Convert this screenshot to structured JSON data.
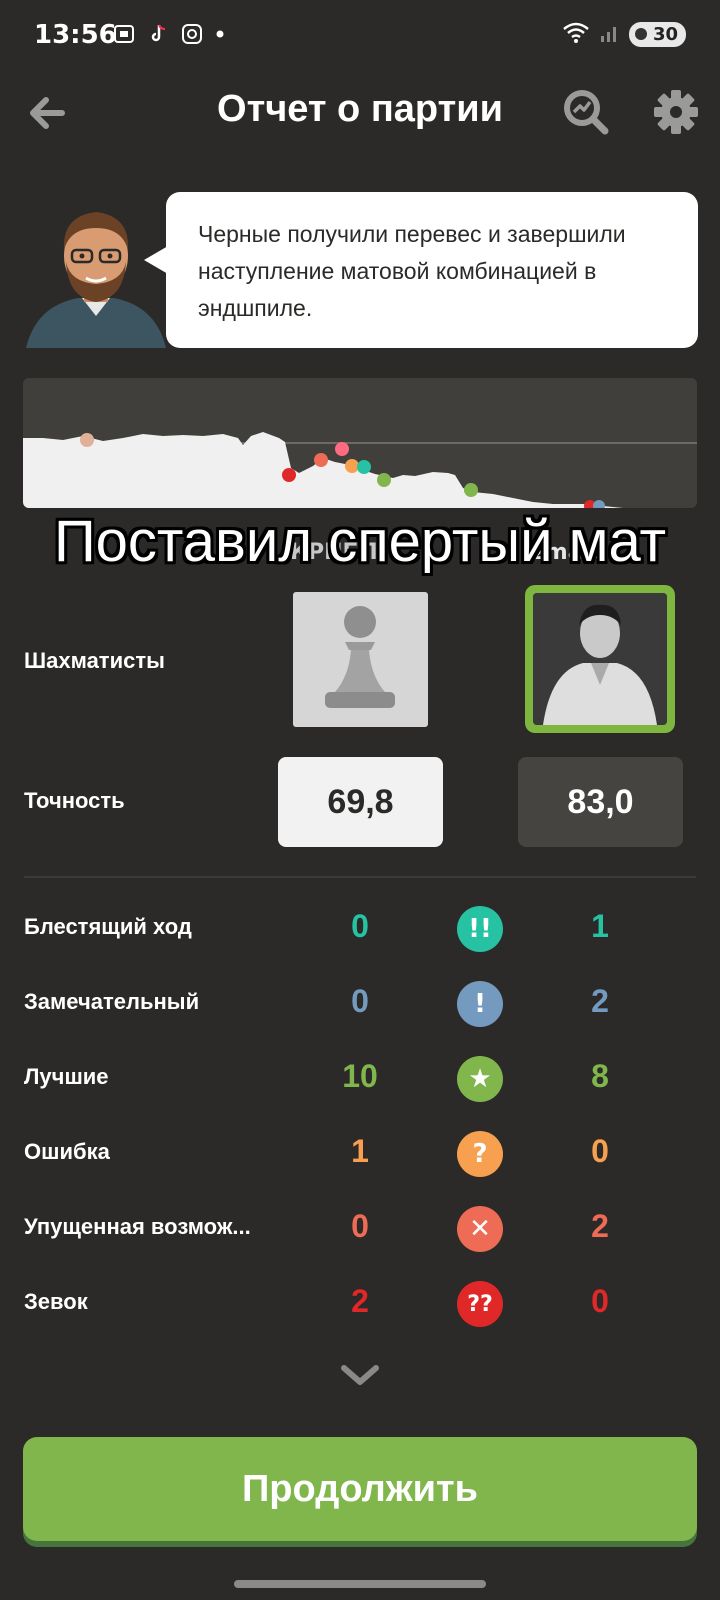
{
  "status_bar": {
    "time": "13:56",
    "battery": "30",
    "left_icons": [
      "screenshot-icon",
      "tiktok-icon",
      "instagram-icon",
      "dot-icon"
    ],
    "right_icons": [
      "wifi-icon",
      "signal-icon",
      "battery-icon"
    ]
  },
  "header": {
    "title": "Отчет о партии",
    "icons": [
      "back-arrow-icon",
      "analysis-search-icon",
      "gear-icon"
    ]
  },
  "coach": {
    "message": "Черные получили перевес и завершили наступление матовой комбинацией в эндшпиле."
  },
  "overlay_caption": "Поставил спертый мат",
  "players": {
    "row_label": "Шахматисты",
    "white_name": "КРНБП",
    "black_name": "zmate",
    "white_avatar_icon": "pawn-icon",
    "black_avatar_icon": "player-photo"
  },
  "accuracy": {
    "label": "Точность",
    "white": "69,8",
    "black": "83,0"
  },
  "stats": [
    {
      "label": "Блестящий ход",
      "white": "0",
      "black": "1",
      "icon": "brilliant-icon",
      "symbol": "!!",
      "color": "#26c2a3"
    },
    {
      "label": "Замечательный",
      "white": "0",
      "black": "2",
      "icon": "great-move-icon",
      "symbol": "!",
      "color": "#749bbf"
    },
    {
      "label": "Лучшие",
      "white": "10",
      "black": "8",
      "icon": "best-move-star-icon",
      "symbol": "★",
      "color": "#81b64c"
    },
    {
      "label": "Ошибка",
      "white": "1",
      "black": "0",
      "icon": "mistake-icon",
      "symbol": "?",
      "color": "#f7a04f"
    },
    {
      "label": "Упущенная возмож...",
      "white": "0",
      "black": "2",
      "icon": "miss-icon",
      "symbol": "✕",
      "color": "#ee6b55"
    },
    {
      "label": "Зевок",
      "white": "2",
      "black": "0",
      "icon": "blunder-icon",
      "symbol": "??",
      "color": "#e02828"
    }
  ],
  "continue_button": {
    "label": "Продолжить",
    "color": "#81b64c"
  }
}
